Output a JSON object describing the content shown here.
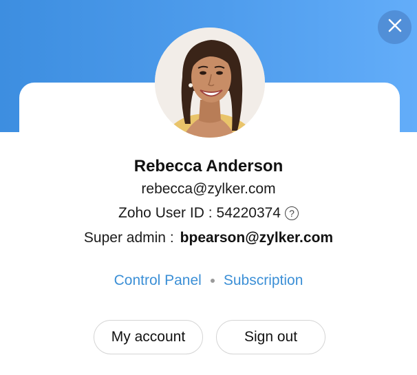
{
  "header": {
    "close_icon": "close-icon"
  },
  "profile": {
    "name": "Rebecca Anderson",
    "email": "rebecca@zylker.com",
    "user_id_label": "Zoho User ID :",
    "user_id_value": "54220374",
    "help_icon_glyph": "?",
    "super_admin_label": "Super admin :",
    "super_admin_email": "bpearson@zylker.com"
  },
  "links": {
    "control_panel": "Control Panel",
    "subscription": "Subscription"
  },
  "actions": {
    "my_account": "My account",
    "sign_out": "Sign out"
  },
  "colors": {
    "header_gradient_start": "#3d8ee0",
    "header_gradient_end": "#63adf9",
    "link": "#3b8fd6"
  }
}
